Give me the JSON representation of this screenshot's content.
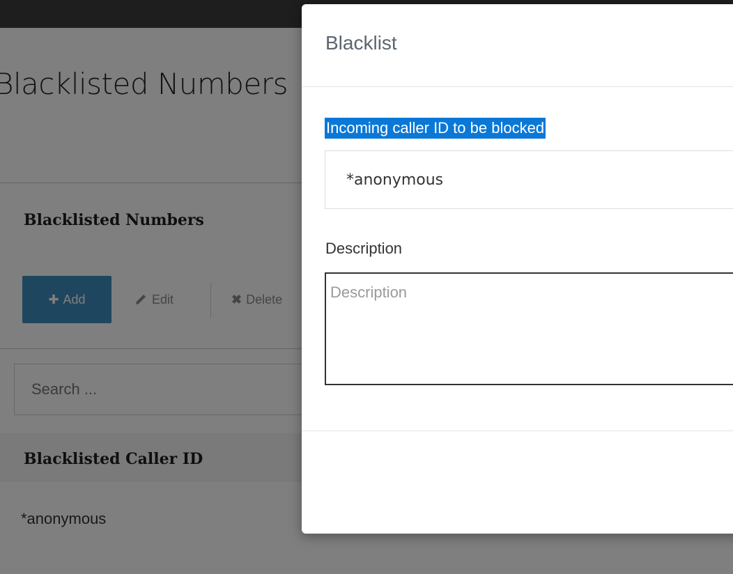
{
  "background": {
    "page_title": "Blacklisted Numbers",
    "panel": {
      "title": "Blacklisted Numbers",
      "toolbar": {
        "add_label": "Add",
        "edit_label": "Edit",
        "delete_label": "Delete"
      },
      "search": {
        "placeholder": "Search ..."
      },
      "table": {
        "columns": [
          "Blacklisted Caller ID"
        ],
        "rows": [
          [
            "*anonymous"
          ]
        ]
      }
    }
  },
  "modal": {
    "title": "Blacklist",
    "fields": {
      "caller_id": {
        "label": "Incoming caller ID to be blocked",
        "value": "*anonymous"
      },
      "description": {
        "label": "Description",
        "placeholder": "Description",
        "value": ""
      }
    }
  },
  "colors": {
    "accent": "#3c8dbc",
    "selection_highlight": "#0a78d7",
    "topbar": "#3c3c3c"
  },
  "icons": {
    "add": "plus-icon",
    "edit": "pencil-icon",
    "delete": "close-icon"
  }
}
